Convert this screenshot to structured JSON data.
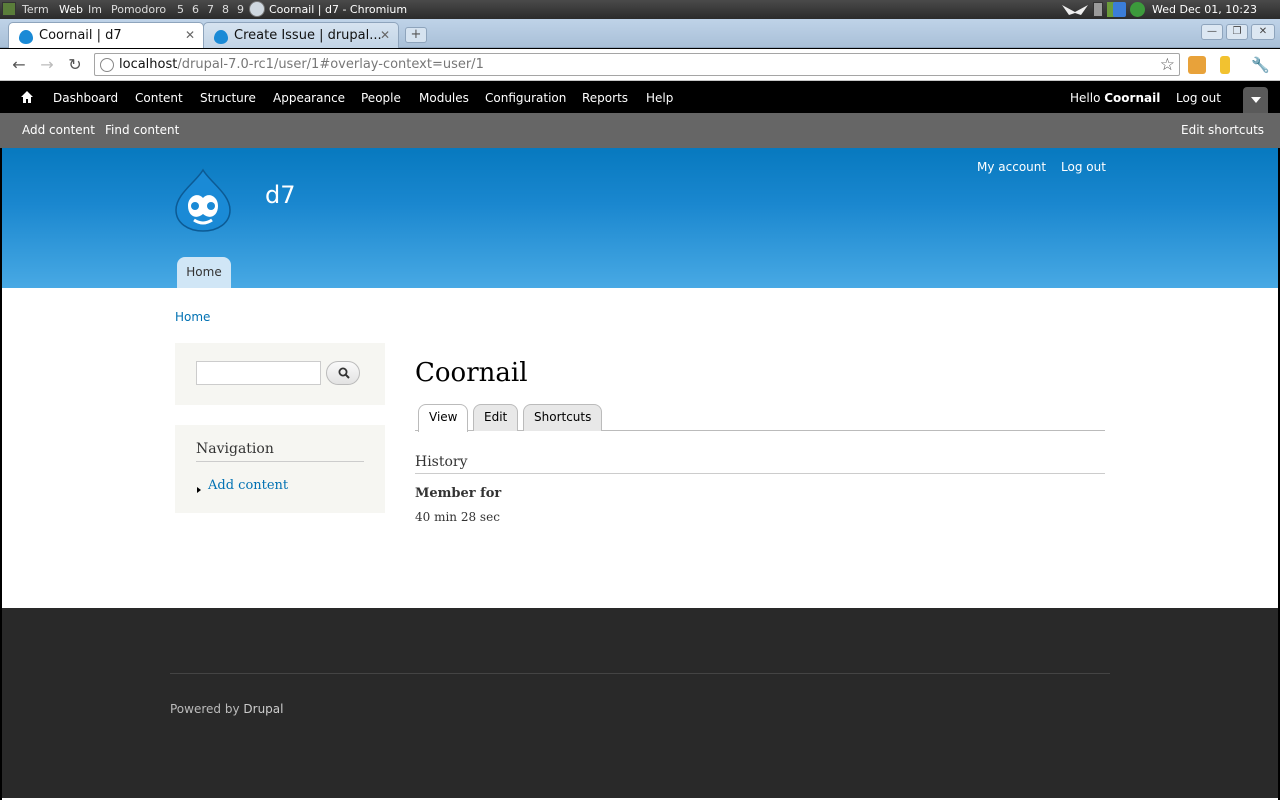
{
  "os_panel": {
    "workspaces": [
      "Term",
      "Web",
      "Im",
      "Pomodoro",
      "5",
      "6",
      "7",
      "8",
      "9"
    ],
    "window_title": "Coornail | d7 - Chromium",
    "clock": "Wed Dec 01, 10:23"
  },
  "browser": {
    "tabs": [
      {
        "label": "Coornail | d7",
        "active": true
      },
      {
        "label": "Create Issue | drupal...",
        "active": false
      }
    ],
    "url_host": "localhost",
    "url_path": "/drupal-7.0-rc1/user/1#overlay-context=user/1"
  },
  "admin_toolbar": {
    "items": [
      "Dashboard",
      "Content",
      "Structure",
      "Appearance",
      "People",
      "Modules",
      "Configuration",
      "Reports",
      "Help"
    ],
    "hello_prefix": "Hello",
    "username": "Coornail",
    "logout": "Log out"
  },
  "shortcuts_bar": {
    "items": [
      "Add content",
      "Find content"
    ],
    "edit_shortcuts": "Edit shortcuts"
  },
  "site": {
    "name": "d7",
    "secondary_menu": [
      "My account",
      "Log out"
    ],
    "main_menu": [
      "Home"
    ],
    "breadcrumb": "Home"
  },
  "sidebar": {
    "search_value": "",
    "navigation_title": "Navigation",
    "navigation_items": [
      "Add content"
    ]
  },
  "content": {
    "title": "Coornail",
    "tabs": [
      "View",
      "Edit",
      "Shortcuts"
    ],
    "active_tab": "View",
    "history_title": "History",
    "member_for_label": "Member for",
    "member_for_value": "40 min 28 sec"
  },
  "footer": {
    "powered_by": "Powered by",
    "drupal_link": "Drupal"
  }
}
